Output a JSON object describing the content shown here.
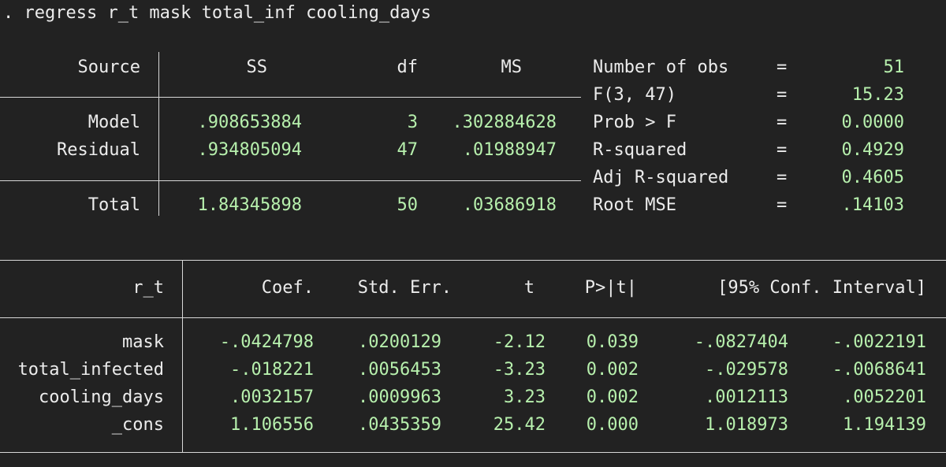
{
  "command": ". regress r_t mask total_inf cooling_days",
  "anova": {
    "headers": {
      "source": "Source",
      "ss": "SS",
      "df": "df",
      "ms": "MS"
    },
    "rows": [
      {
        "label": "Model",
        "ss": ".908653884",
        "df": "3",
        "ms": ".302884628"
      },
      {
        "label": "Residual",
        "ss": ".934805094",
        "df": "47",
        "ms": ".01988947"
      }
    ],
    "total": {
      "label": "Total",
      "ss": "1.84345898",
      "df": "50",
      "ms": ".03686918"
    }
  },
  "stats": [
    {
      "label": "Number of obs",
      "eq": "=",
      "value": "51"
    },
    {
      "label": "F(3, 47)",
      "eq": "=",
      "value": "15.23"
    },
    {
      "label": "Prob > F",
      "eq": "=",
      "value": "0.0000"
    },
    {
      "label": "R-squared",
      "eq": "=",
      "value": "0.4929"
    },
    {
      "label": "Adj R-squared",
      "eq": "=",
      "value": "0.4605"
    },
    {
      "label": "Root MSE",
      "eq": "=",
      "value": ".14103"
    }
  ],
  "coef": {
    "headers": {
      "var": "r_t",
      "coef": "Coef.",
      "se": "Std. Err.",
      "t": "t",
      "p": "P>|t|",
      "ci": "[95% Conf. Interval]"
    },
    "rows": [
      {
        "var": "mask",
        "coef": "-.0424798",
        "se": ".0200129",
        "t": "-2.12",
        "p": "0.039",
        "lo": "-.0827404",
        "hi": "-.0022191"
      },
      {
        "var": "total_infected",
        "coef": "-.018221",
        "se": ".0056453",
        "t": "-3.23",
        "p": "0.002",
        "lo": "-.029578",
        "hi": "-.0068641"
      },
      {
        "var": "cooling_days",
        "coef": ".0032157",
        "se": ".0009963",
        "t": "3.23",
        "p": "0.002",
        "lo": ".0012113",
        "hi": ".0052201"
      },
      {
        "var": "_cons",
        "coef": "1.106556",
        "se": ".0435359",
        "t": "25.42",
        "p": "0.000",
        "lo": "1.018973",
        "hi": "1.194139"
      }
    ]
  }
}
